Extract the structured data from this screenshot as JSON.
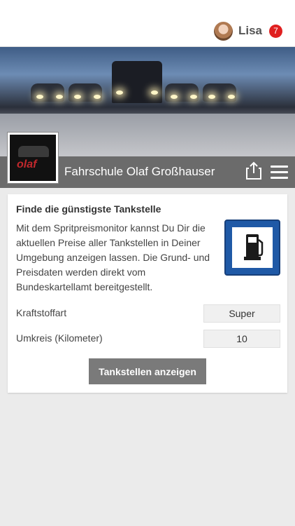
{
  "header": {
    "user_name": "Lisa",
    "notification_count": "7"
  },
  "banner": {
    "logo_text": "olaf",
    "school_name": "Fahrschule Olaf Großhauser"
  },
  "card": {
    "title": "Finde die günstigste Tankstelle",
    "description": "Mit dem Spritpreismonitor kannst Du Dir die aktuellen Preise aller Tankstellen in Deiner Umgebung anzeigen lassen. Die Grund- und Preisdaten werden direkt vom Bundeskartellamt bereitgestellt.",
    "fuel_type_label": "Kraftstoffart",
    "fuel_type_value": "Super",
    "radius_label": "Umkreis (Kilometer)",
    "radius_value": "10",
    "button_label": "Tankstellen anzeigen"
  },
  "colors": {
    "title_bar": "#6b6b6b",
    "badge": "#e02020",
    "button": "#7a7a7a",
    "sign_blue": "#1f59a6"
  },
  "icons": [
    "avatar",
    "share-icon",
    "menu-icon",
    "fuel-station-sign-icon"
  ]
}
